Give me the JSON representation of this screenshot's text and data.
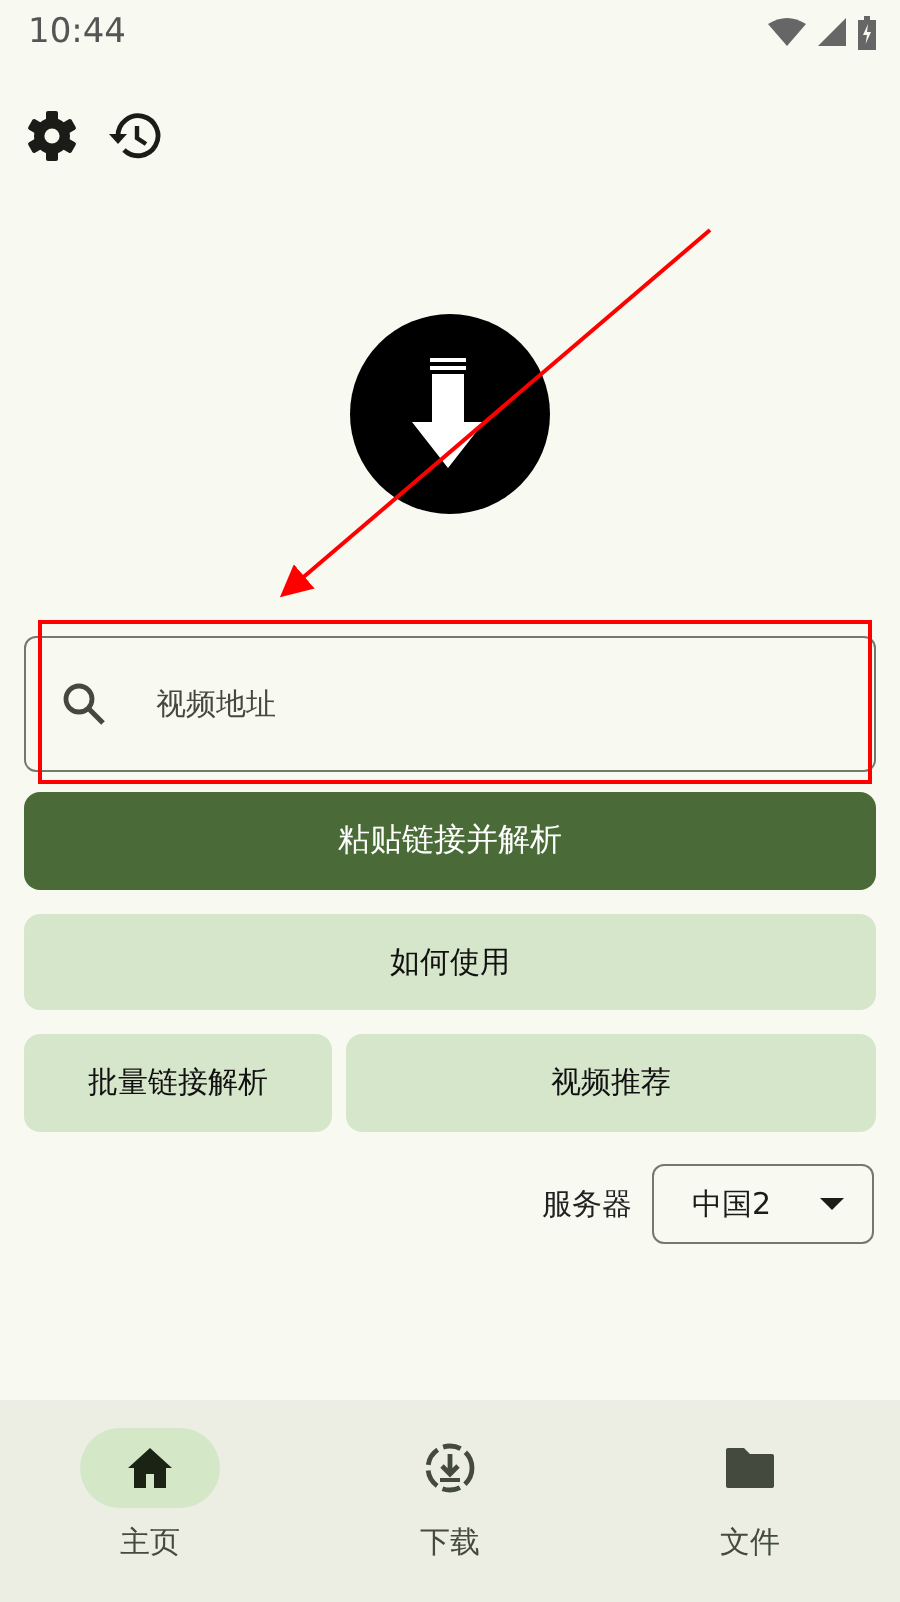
{
  "status_bar": {
    "time": "10:44"
  },
  "search": {
    "placeholder": "视频地址"
  },
  "buttons": [
    {
      "label": "粘贴链接并解析",
      "kind": "primary"
    },
    {
      "label": "如何使用",
      "kind": "tonal"
    }
  ],
  "button_row": [
    {
      "label": "批量链接解析"
    },
    {
      "label": "视频推荐"
    }
  ],
  "server": {
    "label": "服务器",
    "value": "中国2"
  },
  "nav": [
    {
      "label": "主页",
      "kind": "home",
      "selected": true
    },
    {
      "label": "下载",
      "kind": "download",
      "selected": false
    },
    {
      "label": "文件",
      "kind": "folder",
      "selected": false
    }
  ]
}
